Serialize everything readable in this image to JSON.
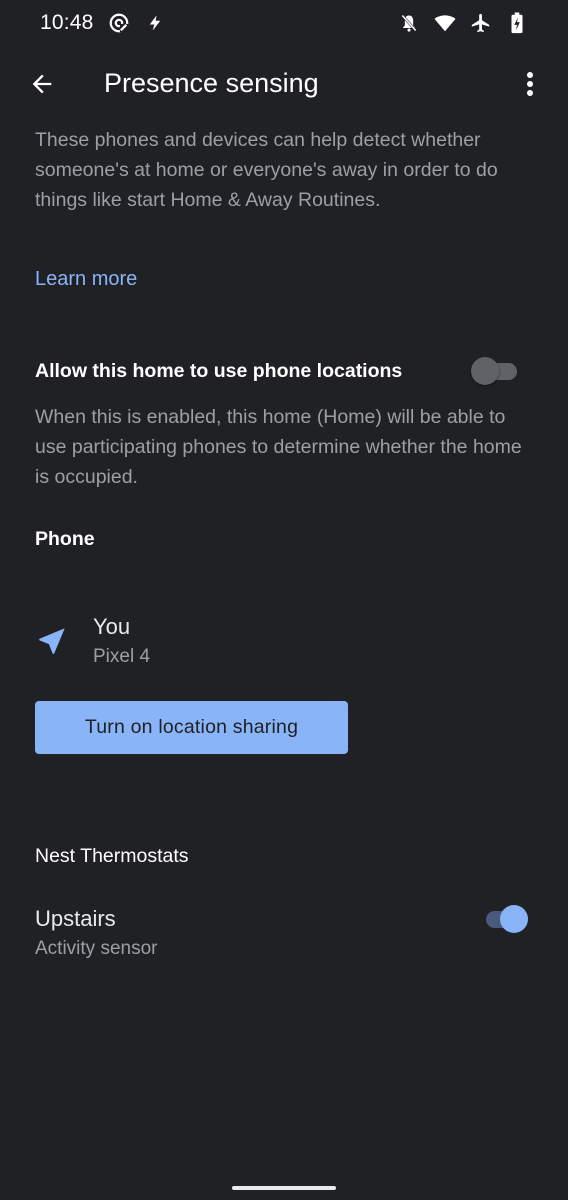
{
  "status_bar": {
    "time": "10:48",
    "left_icons": [
      "hotspot-icon",
      "flash-icon"
    ],
    "right_icons": [
      "notifications-off-icon",
      "wifi-icon",
      "airplane-icon",
      "battery-charging-icon"
    ]
  },
  "app_bar": {
    "title": "Presence sensing",
    "back_icon": "arrow-back-icon",
    "menu_icon": "more-vert-icon"
  },
  "intro_text": "These phones and devices can help detect whether someone's at home or everyone's away in order to do things like start Home & Away Routines.",
  "learn_more": "Learn more",
  "allow_setting": {
    "label": "Allow this home to use phone locations",
    "enabled": false,
    "description": "When this is enabled, this home (Home) will be able to use participating phones to determine whether the home is occupied."
  },
  "phone_section": {
    "title": "Phone",
    "device": {
      "name": "You",
      "model": "Pixel 4",
      "icon": "navigation-arrow-icon"
    },
    "button_label": "Turn on location sharing"
  },
  "nest_section": {
    "title": "Nest Thermostats",
    "item": {
      "name": "Upstairs",
      "subtitle": "Activity sensor",
      "enabled": true
    }
  },
  "colors": {
    "background": "#202124",
    "accent": "#8ab4f8",
    "secondary_text": "#9aa0a6"
  }
}
